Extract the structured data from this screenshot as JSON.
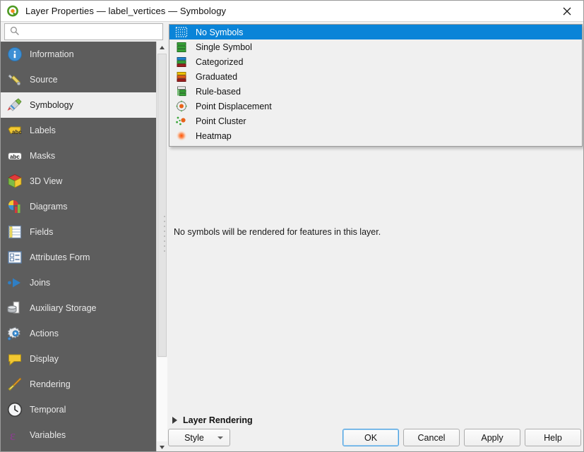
{
  "window": {
    "title": "Layer Properties — label_vertices — Symbology",
    "logo_icon": "qgis-logo-icon",
    "close_icon": "close-icon"
  },
  "search": {
    "placeholder": "",
    "value": "",
    "icon": "search-icon"
  },
  "sidebar": {
    "items": [
      {
        "label": "Information",
        "icon": "information-icon",
        "selected": false
      },
      {
        "label": "Source",
        "icon": "source-icon",
        "selected": false
      },
      {
        "label": "Symbology",
        "icon": "symbology-brush-icon",
        "selected": true
      },
      {
        "label": "Labels",
        "icon": "labels-abc-icon",
        "selected": false
      },
      {
        "label": "Masks",
        "icon": "masks-abc-icon",
        "selected": false
      },
      {
        "label": "3D View",
        "icon": "3d-view-cube-icon",
        "selected": false
      },
      {
        "label": "Diagrams",
        "icon": "diagrams-chart-icon",
        "selected": false
      },
      {
        "label": "Fields",
        "icon": "fields-table-icon",
        "selected": false
      },
      {
        "label": "Attributes Form",
        "icon": "attributes-form-icon",
        "selected": false
      },
      {
        "label": "Joins",
        "icon": "joins-icon",
        "selected": false
      },
      {
        "label": "Auxiliary Storage",
        "icon": "auxiliary-storage-icon",
        "selected": false
      },
      {
        "label": "Actions",
        "icon": "actions-gear-icon",
        "selected": false
      },
      {
        "label": "Display",
        "icon": "display-balloon-icon",
        "selected": false
      },
      {
        "label": "Rendering",
        "icon": "rendering-broom-icon",
        "selected": false
      },
      {
        "label": "Temporal",
        "icon": "temporal-clock-icon",
        "selected": false
      },
      {
        "label": "Variables",
        "icon": "variables-epsilon-icon",
        "selected": false
      }
    ],
    "scrollbar": {
      "up_icon": "scroll-up-arrow-icon",
      "down_icon": "scroll-down-arrow-icon"
    }
  },
  "renderer_dropdown": {
    "options": [
      {
        "label": "No Symbols",
        "icon": "no-symbols-icon",
        "selected": true
      },
      {
        "label": "Single Symbol",
        "icon": "single-symbol-icon",
        "selected": false
      },
      {
        "label": "Categorized",
        "icon": "categorized-icon",
        "selected": false
      },
      {
        "label": "Graduated",
        "icon": "graduated-icon",
        "selected": false
      },
      {
        "label": "Rule-based",
        "icon": "rule-based-icon",
        "selected": false
      },
      {
        "label": "Point Displacement",
        "icon": "point-displacement-icon",
        "selected": false
      },
      {
        "label": "Point Cluster",
        "icon": "point-cluster-icon",
        "selected": false
      },
      {
        "label": "Heatmap",
        "icon": "heatmap-icon",
        "selected": false
      }
    ]
  },
  "main": {
    "message": "No symbols will be rendered for features in this layer."
  },
  "layer_rendering": {
    "label": "Layer Rendering",
    "expander_icon": "expand-triangle-icon",
    "expanded": false
  },
  "buttons": {
    "style": "Style",
    "style_caret_icon": "caret-down-icon",
    "ok": "OK",
    "cancel": "Cancel",
    "apply": "Apply",
    "help": "Help"
  },
  "colors": {
    "sidebar_bg": "#5d5d5d",
    "sidebar_selected_bg": "#efefef",
    "highlight_blue": "#0a84d8",
    "panel_bg": "#f0f0f0",
    "focus_border": "#4a9fe0"
  }
}
